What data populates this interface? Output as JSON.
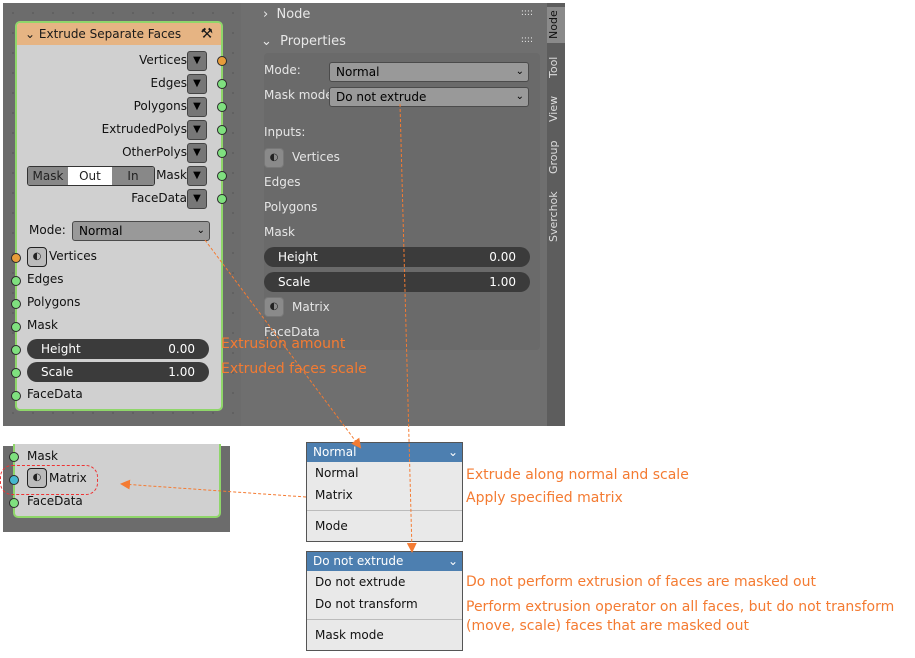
{
  "node": {
    "title": "Extrude Separate Faces",
    "outputs": [
      "Vertices",
      "Edges",
      "Polygons",
      "ExtrudedPolys",
      "OtherPolys",
      "Mask",
      "FaceData"
    ],
    "mask_toggle": [
      "Mask",
      "Out",
      "In"
    ],
    "mode_label": "Mode:",
    "mode_value": "Normal",
    "inputs": [
      "Vertices",
      "Edges",
      "Polygons",
      "Mask",
      "FaceData"
    ],
    "height_label": "Height",
    "height_value": "0.00",
    "scale_label": "Scale",
    "scale_value": "1.00"
  },
  "panel": {
    "node_header": "Node",
    "properties_header": "Properties",
    "mode_label": "Mode:",
    "mode_value": "Normal",
    "mask_mode_label": "Mask mode:",
    "mask_mode_value": "Do not extrude",
    "inputs_label": "Inputs:",
    "vertices": "Vertices",
    "edges": "Edges",
    "polygons": "Polygons",
    "mask": "Mask",
    "height_label": "Height",
    "height_value": "0.00",
    "scale_label": "Scale",
    "scale_value": "1.00",
    "matrix": "Matrix",
    "facedata": "FaceData"
  },
  "tabs": [
    "Node",
    "Tool",
    "View",
    "Group",
    "Sverchok"
  ],
  "annotations": {
    "height": "Extrusion amount",
    "scale": "Extruded faces scale",
    "normal": "Extrude along normal and scale",
    "matrix": "Apply specified matrix",
    "no_extrude": "Do not perform extrusion of faces are masked out",
    "no_transform_1": "Perform extrusion operator on all faces, but do not transform",
    "no_transform_2": "(move, scale) faces that are masked out"
  },
  "inset": {
    "mask": "Mask",
    "matrix": "Matrix",
    "facedata": "FaceData"
  },
  "mode_menu": {
    "header": "Normal",
    "items": [
      "Normal",
      "Matrix"
    ],
    "title": "Mode"
  },
  "mask_menu": {
    "header": "Do not extrude",
    "items": [
      "Do not extrude",
      "Do not transform"
    ],
    "title": "Mask mode"
  },
  "colors": {
    "accent": "#f47b32",
    "socket_green": "#7fe07f",
    "socket_orange": "#e79c3b",
    "header": "#e6b483"
  }
}
